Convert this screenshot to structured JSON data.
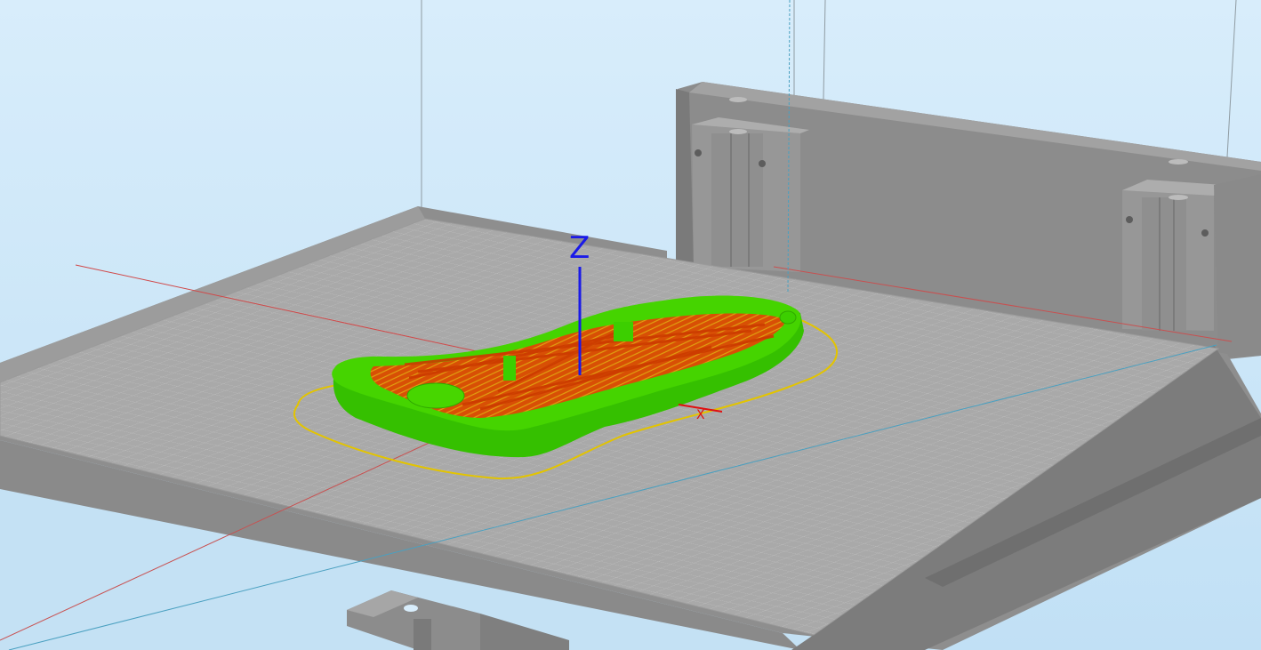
{
  "viewport": {
    "axis_z_label": "Z",
    "axis_x_label": "X"
  },
  "colors": {
    "background_top": "#d6ecfb",
    "background_bottom": "#c3e1f6",
    "bed_surface": "#a8a8a8",
    "bed_side": "#8e8e8e",
    "bed_grid": "#bdbdbd",
    "frame": "#8a8a8a",
    "frame_dark": "#6e6e6e",
    "perimeter_green": "#3ecf00",
    "infill_orange": "#e05a00",
    "skirt_yellow": "#e3c400",
    "axis_z": "#1a1ae8",
    "axis_x": "#e01010",
    "guide_red": "#d24a4a",
    "guide_cyan": "#4aa8c8",
    "build_volume_line": "#9aa6ad"
  }
}
